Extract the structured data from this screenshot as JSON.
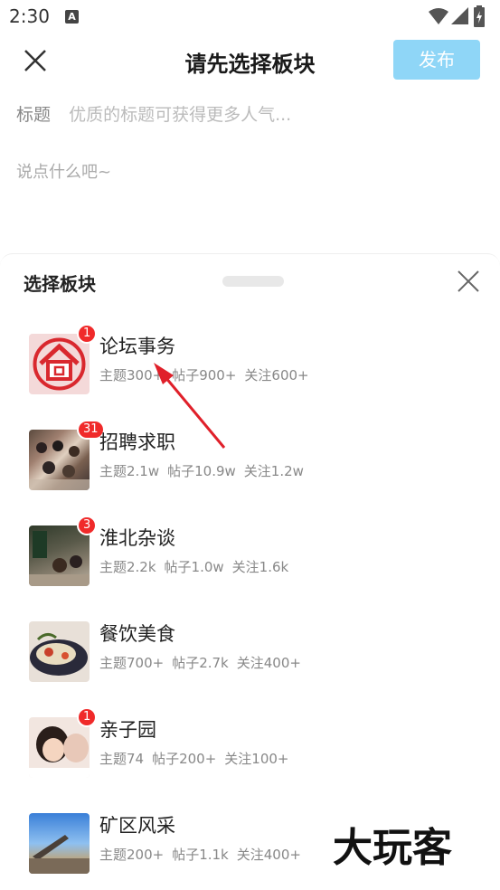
{
  "status_bar": {
    "time": "2:30",
    "notification_letter": "A"
  },
  "header": {
    "title": "请先选择板块",
    "publish_label": "发布"
  },
  "composer": {
    "title_label": "标题",
    "title_placeholder": "优质的标题可获得更多人气...",
    "body_placeholder": "说点什么吧~"
  },
  "sheet": {
    "title": "选择板块",
    "forums": [
      {
        "name": "论坛事务",
        "badge": "1",
        "topics": "主题300+",
        "posts": "帖子900+",
        "follows": "关注600+",
        "thumb_icon": "house-logo-icon"
      },
      {
        "name": "招聘求职",
        "badge": "31",
        "topics": "主题2.1w",
        "posts": "帖子10.9w",
        "follows": "关注1.2w",
        "thumb_icon": "crowd-photo"
      },
      {
        "name": "淮北杂谈",
        "badge": "3",
        "topics": "主题2.2k",
        "posts": "帖子1.0w",
        "follows": "关注1.6k",
        "thumb_icon": "street-photo"
      },
      {
        "name": "餐饮美食",
        "badge": "",
        "topics": "主题700+",
        "posts": "帖子2.7k",
        "follows": "关注400+",
        "thumb_icon": "food-photo"
      },
      {
        "name": "亲子园",
        "badge": "1",
        "topics": "主题74",
        "posts": "帖子200+",
        "follows": "关注100+",
        "thumb_icon": "child-photo"
      },
      {
        "name": "矿区风采",
        "badge": "",
        "topics": "主题200+",
        "posts": "帖子1.1k",
        "follows": "关注400+",
        "thumb_icon": "mine-photo"
      }
    ]
  },
  "watermark": "大玩客",
  "colors": {
    "publish_bg": "#8fd6f7",
    "badge": "#f02a2a",
    "logo_red": "#d9282e"
  }
}
